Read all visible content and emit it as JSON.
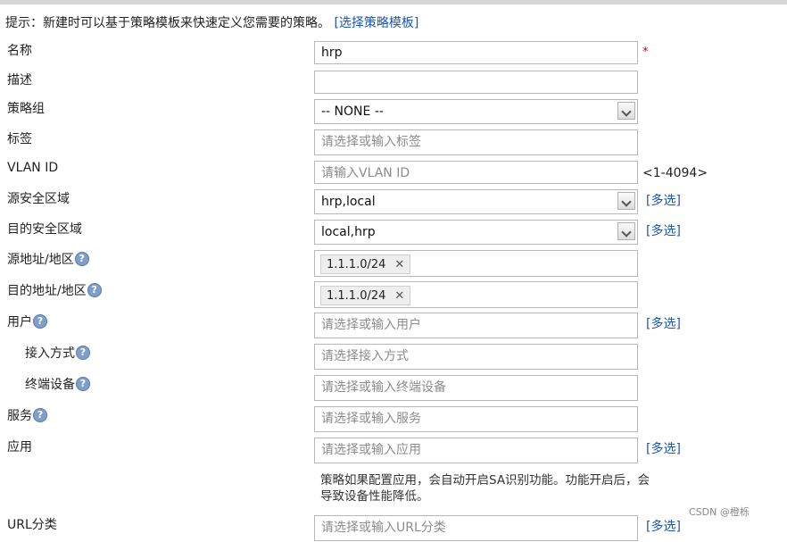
{
  "hint": {
    "text": "提示：新建时可以基于策略模板来快速定义您需要的策略。",
    "link": "[选择策略模板]"
  },
  "required_mark": "*",
  "multi_label": "[多选]",
  "fields": {
    "name": {
      "label": "名称",
      "value": "hrp"
    },
    "desc": {
      "label": "描述",
      "value": ""
    },
    "group": {
      "label": "策略组",
      "value": "-- NONE --"
    },
    "tags": {
      "label": "标签",
      "placeholder": "请选择或输入标签"
    },
    "vlan": {
      "label": "VLAN ID",
      "placeholder": "请输入VLAN ID",
      "range": "<1-4094>"
    },
    "src_zone": {
      "label": "源安全区域",
      "value": "hrp,local"
    },
    "dst_zone": {
      "label": "目的安全区域",
      "value": "local,hrp"
    },
    "src_addr": {
      "label": "源地址/地区",
      "tag": "1.1.1.0/24"
    },
    "dst_addr": {
      "label": "目的地址/地区",
      "tag": "1.1.1.0/24"
    },
    "user": {
      "label": "用户",
      "placeholder": "请选择或输入用户"
    },
    "access": {
      "label": "接入方式",
      "placeholder": "请选择接入方式"
    },
    "terminal": {
      "label": "终端设备",
      "placeholder": "请选择或输入终端设备"
    },
    "service": {
      "label": "服务",
      "placeholder": "请选择或输入服务"
    },
    "app": {
      "label": "应用",
      "placeholder": "请选择或输入应用"
    },
    "url": {
      "label": "URL分类",
      "placeholder": "请选择或输入URL分类"
    }
  },
  "app_note": "策略如果配置应用，会自动开启SA识别功能。功能开启后，会导致设备性能降低。",
  "watermark": "CSDN @橙栎"
}
